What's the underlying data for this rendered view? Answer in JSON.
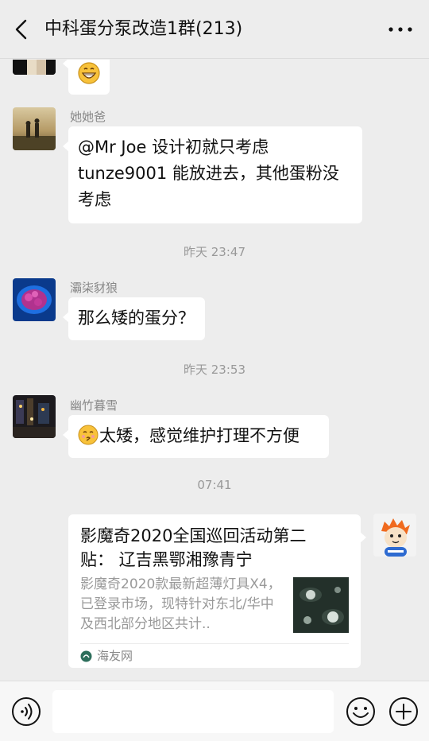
{
  "header": {
    "title": "中科蛋分泵改造1群(213)"
  },
  "messages": [
    {
      "type": "emoji_only",
      "icon": "grin-emoji-icon"
    },
    {
      "sender": "她她爸",
      "text": "@Mr Joe  设计初就只考虑tunze9001 能放进去，其他蛋粉没考虑"
    },
    {
      "timestamp": "昨天 23:47"
    },
    {
      "sender": "灞柒豺狼",
      "text": "那么矮的蛋分？"
    },
    {
      "timestamp": "昨天 23:53"
    },
    {
      "sender": "幽竹暮雪",
      "emoji": "kiss-emoji-icon",
      "text": "太矮，感觉维护打理不方便"
    },
    {
      "timestamp": "07:41"
    }
  ],
  "link_card": {
    "title": "影魔奇2020全国巡回活动第二贴：  辽吉黑鄂湘豫青宁",
    "description": "影魔奇2020款最新超薄灯具X4，已登录市场，现特针对东北/华中及西北部分地区共计..",
    "source": "海友网",
    "source_icon": "haiyou-logo-icon",
    "thumb": "lamp-thumbnail-image"
  },
  "input": {
    "value": "",
    "placeholder": ""
  },
  "colors": {
    "background": "#ededed",
    "bubble": "#ffffff",
    "timestamp": "#999999"
  }
}
